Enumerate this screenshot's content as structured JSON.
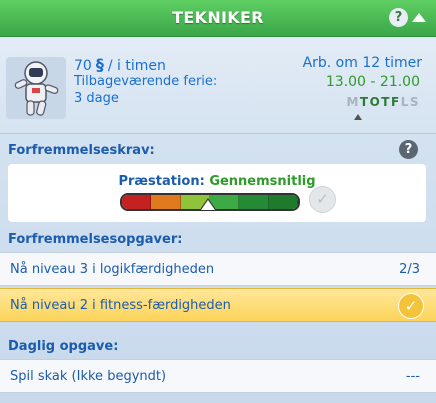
{
  "header": {
    "title": "Tekniker"
  },
  "info": {
    "pay_amount": "70",
    "pay_unit": "/ i timen",
    "currency_symbol": "§",
    "vacation_label": "Tilbageværende ferie:",
    "vacation_value": "3 dage",
    "work_in": "Arb. om 12 timer",
    "hours": "13.00 - 21.00",
    "days": [
      {
        "letter": "M",
        "work": false
      },
      {
        "letter": "T",
        "work": true
      },
      {
        "letter": "O",
        "work": true
      },
      {
        "letter": "T",
        "work": true
      },
      {
        "letter": "F",
        "work": true
      },
      {
        "letter": "L",
        "work": false
      },
      {
        "letter": "S",
        "work": false
      }
    ]
  },
  "promotion": {
    "label": "Forfremmelseskrav:",
    "performance_key": "Præstation:",
    "performance_value": "Gennemsnitlig",
    "performance_level": 0.5,
    "meter_colors": [
      "#c62121",
      "#e07a1e",
      "#8fc33a",
      "#3eaa45",
      "#258a35",
      "#1f7a2c"
    ]
  },
  "tasks": {
    "label": "Forfremmelsesopgaver:",
    "items": [
      {
        "text": "Nå niveau 3 i logikfærdigheden",
        "progress": "2/3",
        "done": false
      },
      {
        "text": "Nå niveau 2 i fitness-færdigheden",
        "progress": "",
        "done": true
      }
    ]
  },
  "daily": {
    "label": "Daglig opgave:",
    "text": "Spil skak (Ikke begyndt)",
    "progress": "---"
  }
}
